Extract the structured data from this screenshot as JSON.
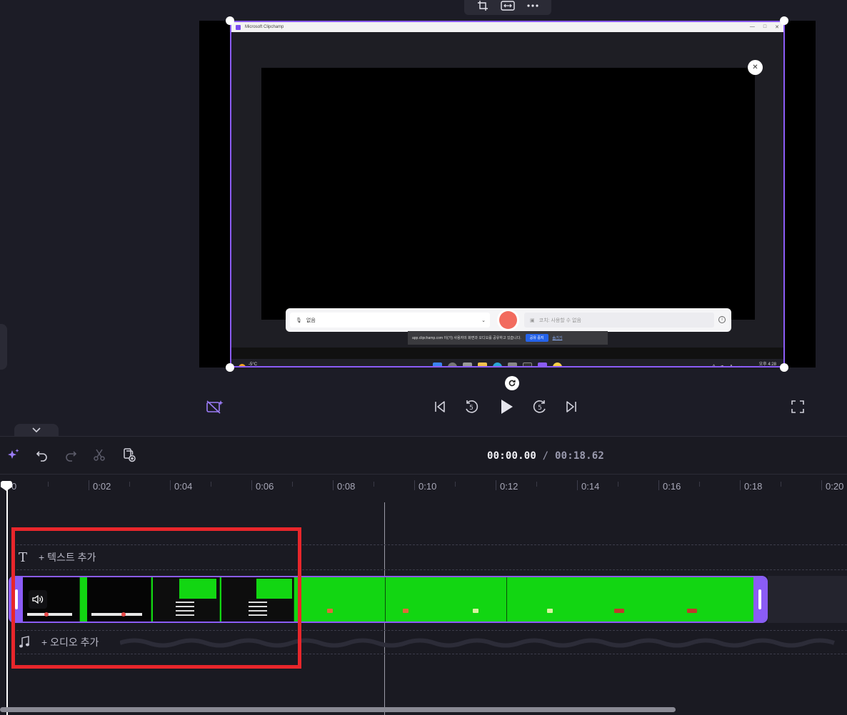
{
  "preview": {
    "window_title": "Microsoft Clipchamp",
    "mic_value": "없음",
    "camera_placeholder": "코치: 사용할 수 없음",
    "share_banner_text": "app.clipchamp.com 이(가) 사용자의 화면과 오디오를 공유하고 있습니다.",
    "share_stop_label": "공유 중지",
    "share_hide_label": "숨기기",
    "taskbar_weather_temp": "-5°C",
    "taskbar_weather_desc": "맑음",
    "taskbar_time": "오후 4:28",
    "taskbar_date": "2025-02-05"
  },
  "timeline": {
    "current_time": "00:00.00",
    "separator": "/",
    "total_time": "00:18.62",
    "ruler_labels": [
      "0",
      "0:02",
      "0:04",
      "0:06",
      "0:08",
      "0:10",
      "0:12",
      "0:14",
      "0:16",
      "0:18",
      "0:20"
    ],
    "text_track_label": "+ 텍스트 추가",
    "audio_track_label": "+ 오디오 추가"
  },
  "colors": {
    "accent": "#8b5cf6",
    "clip_green": "#12d612",
    "highlight_red": "#e8262b",
    "record_red": "#f26b5e"
  },
  "icons": {
    "float_toolbar": [
      "crop-icon",
      "fit-icon",
      "more-icon"
    ],
    "playback": [
      "ai-camera-off-icon",
      "skip-back-icon",
      "rewind-5-icon",
      "play-icon",
      "forward-5-icon",
      "skip-forward-icon",
      "fullscreen-icon"
    ],
    "timeline_tools": [
      "magic-icon",
      "undo-icon",
      "redo-icon",
      "cut-icon",
      "add-clip-icon"
    ]
  }
}
